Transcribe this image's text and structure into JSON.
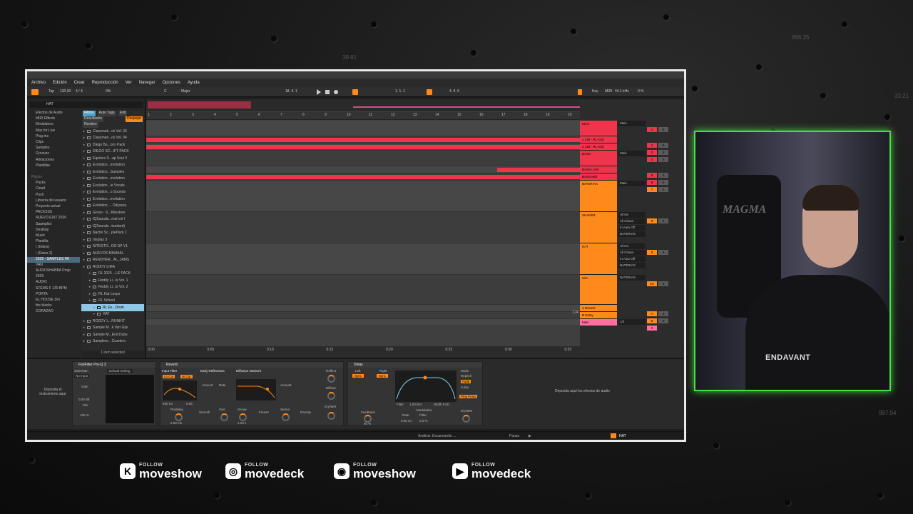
{
  "overlay": {
    "ghost_top": "39.81",
    "ghost_right_top": "856.25",
    "ghost_right_mid": "33.21",
    "ghost_right_bottom": "997.54"
  },
  "menu": [
    "Archivo",
    "Edición",
    "Crear",
    "Reproducción",
    "Ver",
    "Navegar",
    "Opciones",
    "Ayuda"
  ],
  "toolbar": {
    "tap": "Tap",
    "tempo": "130.00",
    "signature": "4 / 4",
    "percent": "0%",
    "key": "C",
    "scale": "Major",
    "position": "18. 4. 1",
    "loop_start": "1. 1. 1",
    "loop_len": "4. 0. 0",
    "key_btn": "Key",
    "midi": "MIDI",
    "khz": "44.1 kHz",
    "cpu": "0 %"
  },
  "browser": {
    "search": "HAT",
    "places": [
      {
        "label": "Efectos de Audio",
        "kind": "item"
      },
      {
        "label": "MIDI Effects",
        "kind": "item"
      },
      {
        "label": "Modulators",
        "kind": "item"
      },
      {
        "label": "Max for Live",
        "kind": "item"
      },
      {
        "label": "Plug-ins",
        "kind": "item"
      },
      {
        "label": "Clips",
        "kind": "item"
      },
      {
        "label": "Samples",
        "kind": "item"
      },
      {
        "label": "Grooves",
        "kind": "item"
      },
      {
        "label": "Afinaciones",
        "kind": "item"
      },
      {
        "label": "Plantillas",
        "kind": "item"
      },
      {
        "label": "",
        "kind": "item"
      },
      {
        "label": "Places",
        "kind": "hd"
      },
      {
        "label": "Packs",
        "kind": "item"
      },
      {
        "label": "Cloud",
        "kind": "item"
      },
      {
        "label": "Push",
        "kind": "item"
      },
      {
        "label": "Librería del usuario",
        "kind": "item"
      },
      {
        "label": "Proyecto actual",
        "kind": "item"
      },
      {
        "label": "PACKSSS",
        "kind": "item"
      },
      {
        "label": "NUEVO EDIT 2026",
        "kind": "item"
      },
      {
        "label": "Saamplist",
        "kind": "item"
      },
      {
        "label": "Desktop",
        "kind": "item"
      },
      {
        "label": "Music",
        "kind": "item"
      },
      {
        "label": "Plantilla",
        "kind": "item"
      },
      {
        "label": "\\ (Datos)",
        "kind": "item"
      },
      {
        "label": "\\ (Datos 2)",
        "kind": "item"
      },
      {
        "label": "2025 - SAMPLES PA",
        "kind": "sel"
      },
      {
        "label": "VAN",
        "kind": "item"
      },
      {
        "label": "AUDIOSHABBA Proje",
        "kind": "item"
      },
      {
        "label": "2026",
        "kind": "item"
      },
      {
        "label": "AUDIO",
        "kind": "item"
      },
      {
        "label": "STEMS F 130 BPM",
        "kind": "item"
      },
      {
        "label": "PORTA",
        "kind": "item"
      },
      {
        "label": "EL HOUSE Dm",
        "kind": "item"
      },
      {
        "label": "the blacks",
        "kind": "item"
      },
      {
        "label": "CORAZAO",
        "kind": "item"
      }
    ],
    "filters": "Filtros",
    "auto_tag": "Auto Tags",
    "edit": "Edit",
    "results": "Resultados",
    "clear": "Despejar",
    "name_col": "Nombre",
    "files": [
      "Classmati...ck Vol. 03",
      "Classmati...ck Vol. 04",
      "Diego Bu...ons Pack",
      "DIEGO SC...IFT PACK",
      "Equinox S...ap Soul 3",
      "Evolution...evolution",
      "Evolution...Samples",
      "Evolution...evolution",
      "Evolution...ie Vocals",
      "Evolution...o Sounds",
      "Evolution...evolution",
      "Evolution...- Odyssey",
      "Groso - S...Ritestore",
      "IQSounds...mal vol I",
      "IQSounds...tandard)",
      "Nacho Sc...plePack 1",
      "ntsplas 3",
      "NITESTO...OO SP V1",
      "NUEVOS MINIMAL",
      "RENDHER...AL_JAMS",
      "RODDY LIMA",
      "RL 2025 ...LE PACK",
      "Roddy Li...is Vol. 1",
      "Roddy Li...is Vol. 2",
      "RL Hat Loops",
      "RL School",
      "RL Ex...Drum",
      "HAT",
      "RODDY L...RUNKIT",
      "Sample M...k Van Gijs",
      "Sample M...End Dubs",
      "Samplem... Cuarters"
    ],
    "status": "1 item selected"
  },
  "ruler": [
    "1",
    "2",
    "3",
    "4",
    "5",
    "6",
    "7",
    "8",
    "9",
    "10",
    "11",
    "12",
    "13",
    "14",
    "15",
    "16",
    "17",
    "18",
    "19",
    "20"
  ],
  "timeline": [
    "0:00",
    "0:05",
    "0:10",
    "0:15",
    "0:20",
    "0:25",
    "0:30",
    "0:35"
  ],
  "arrange_bar_ratio": "1/4",
  "tracks": [
    {
      "name": "KICK",
      "color": "#f0344b",
      "io": [
        "Main"
      ],
      "nums": [
        "1",
        "S"
      ]
    },
    {
      "name": "1 128 - RL Kick",
      "color": "#f0344b",
      "io": [],
      "nums": [
        "2",
        "S"
      ]
    },
    {
      "name": "2 128 - RL Kick",
      "color": "#f0344b",
      "io": [],
      "nums": [
        "3",
        "S"
      ]
    },
    {
      "name": "BASS",
      "color": "#f0344b",
      "io": [
        "Main"
      ],
      "nums": [
        "4",
        "S"
      ]
    },
    {
      "name": "BASS LOW",
      "color": "#f0344b",
      "io": [],
      "nums": [
        "5",
        "S"
      ]
    },
    {
      "name": "BASS MID",
      "color": "#f0344b",
      "io": [],
      "nums": [
        "6",
        "S"
      ]
    },
    {
      "name": "BATERIAS",
      "color": "#ff8a1c",
      "io": [
        "Main"
      ],
      "nums": [
        "7",
        "S"
      ]
    },
    {
      "name": "SHAKER",
      "color": "#ff8a1c",
      "io": [
        "All Ins",
        "All Chann",
        "In Auto Off",
        "BATERIAS"
      ],
      "nums": [
        "8",
        "S"
      ]
    },
    {
      "name": "HAT",
      "color": "#ff8a1c",
      "io": [
        "All Ins",
        "All Chann",
        "In Auto Off",
        "BATERIAS"
      ],
      "nums": [
        "9",
        "S"
      ]
    },
    {
      "name": "Hits",
      "color": "#ff8a1c",
      "io": [
        "BATERIAS"
      ],
      "nums": [
        "10",
        "S"
      ]
    },
    {
      "name": "A Reverb",
      "color": "#ff8a1c",
      "io": [],
      "nums": [
        "A",
        "S"
      ]
    },
    {
      "name": "B Delay",
      "color": "#ff8a1c",
      "io": [],
      "nums": [
        "B",
        "S"
      ]
    },
    {
      "name": "Main",
      "color": "#ff6fa0",
      "io": [
        "1/2"
      ],
      "nums": [
        "0"
      ]
    }
  ],
  "devices": {
    "drop_instrument": "Deposita el instrumento aquí",
    "drop_effects": "Deposita aquí los efectos de audio",
    "fabfilter": "FabFilter Pro-Q 3",
    "sidechain": "Sidechain",
    "no_input": "No Input",
    "gain": "Gain",
    "gain_val": "0.00 dB",
    "mix": "Mix",
    "mix_val": "100 %",
    "default": "Default Setting",
    "reverb": "Reverb",
    "input_filter": "Input Filter",
    "early_ref": "Early Reflections",
    "diffusion_net": "Diffusion Network",
    "lo_cut": "Lo Cut",
    "hi_cut": "Hi Cut",
    "freq1": "830 Hz",
    "freq2": "5.85",
    "amount": "Amount",
    "rate": "Rate",
    "predelay": "Predelay",
    "predelay_val": "2.50 ms",
    "smooth": "Smooth",
    "size": "Size",
    "decay": "Decay",
    "decay_val": "1.20 s",
    "freeze": "Freeze",
    "stereo": "Stereo",
    "density": "Density",
    "reflect": "Reflect",
    "diffuse": "Diffuse",
    "drywet": "Dry/Wet",
    "delay": "Delay",
    "left": "Left",
    "right": "Right",
    "sync": "Sync",
    "feedback": "Feedback",
    "feedback_val": "50 %",
    "filter": "Filter",
    "filter_val": "1.00 kHz",
    "width_val": "Width 9.00",
    "modulation": "Modulation",
    "rate_val": "0.50 Hz",
    "mode": "Mode",
    "repitch": "Repitch",
    "fade": "Fade",
    "jump": "Jump",
    "ping_pong": "Ping Pong",
    "mod_pct": "0.0 %"
  },
  "status": {
    "analysis": "Análisis: Escaneando ...",
    "pause": "Pausa",
    "track": "HAT"
  },
  "webcam": {
    "chair_logo": "MAGMA",
    "shirt": "ENDAVANT"
  },
  "social": [
    {
      "icon": "K",
      "follow": "FOLLOW",
      "handle": "moveshow",
      "color": "#ffffff"
    },
    {
      "icon": "◎",
      "follow": "FOLLOW",
      "handle": "movedeck",
      "color": "#ffffff"
    },
    {
      "icon": "◉",
      "follow": "FOLLOW",
      "handle": "moveshow",
      "color": "#ffffff"
    },
    {
      "icon": "▶",
      "follow": "FOLLOW",
      "handle": "movedeck",
      "color": "#ffffff"
    }
  ]
}
